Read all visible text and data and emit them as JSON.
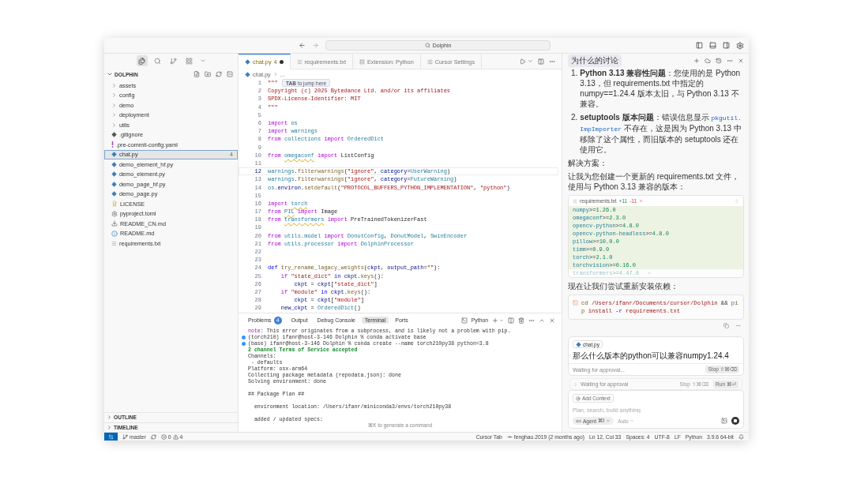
{
  "titlebar": {
    "search": "Dolphin"
  },
  "activity_bar": [
    {
      "kind": "files",
      "selected": true
    },
    {
      "kind": "search",
      "selected": false
    },
    {
      "kind": "source-control",
      "selected": false
    },
    {
      "kind": "extensions",
      "selected": false
    }
  ],
  "explorer": {
    "title": "DOLPHIN",
    "expanded": true,
    "items": [
      {
        "label": "assets",
        "kind": "folder",
        "expanded": false,
        "selected": false
      },
      {
        "label": "config",
        "kind": "folder",
        "expanded": false,
        "selected": false
      },
      {
        "label": "demo",
        "kind": "folder",
        "expanded": false,
        "selected": false
      },
      {
        "label": "deployment",
        "kind": "folder",
        "expanded": false,
        "selected": false
      },
      {
        "label": "utils",
        "kind": "folder",
        "expanded": false,
        "selected": false
      },
      {
        "label": ".gitignore",
        "kind": "git",
        "selected": false
      },
      {
        "label": ".pre-commit-config.yaml",
        "kind": "yaml",
        "selected": false
      },
      {
        "label": "chat.py",
        "kind": "python",
        "selected": true,
        "badge": "4"
      },
      {
        "label": "demo_element_hf.py",
        "kind": "python",
        "selected": false
      },
      {
        "label": "demo_element.py",
        "kind": "python",
        "selected": false
      },
      {
        "label": "demo_page_hf.py",
        "kind": "python",
        "selected": false
      },
      {
        "label": "demo_page.py",
        "kind": "python",
        "selected": false
      },
      {
        "label": "LICENSE",
        "kind": "license",
        "selected": false
      },
      {
        "label": "pyproject.toml",
        "kind": "toml",
        "selected": false
      },
      {
        "label": "README_CN.md",
        "kind": "markdown",
        "selected": false
      },
      {
        "label": "README.md",
        "kind": "info",
        "selected": false
      },
      {
        "label": "requirements.txt",
        "kind": "text",
        "selected": false
      }
    ],
    "sections": [
      {
        "title": "OUTLINE",
        "expanded": false
      },
      {
        "title": "TIMELINE",
        "expanded": false
      }
    ]
  },
  "editor": {
    "tabs": [
      {
        "label": "chat.py",
        "kind": "python",
        "badge": "4",
        "modified": true,
        "selected": true
      },
      {
        "label": "requirements.txt",
        "kind": "text",
        "modified": false,
        "selected": false
      },
      {
        "label": "Extension: Python",
        "kind": "extension",
        "modified": false,
        "selected": false
      },
      {
        "label": "Cursor Settings",
        "kind": "settings",
        "modified": false,
        "selected": false
      }
    ],
    "breadcrumb": {
      "file": "chat.py",
      "rest": "..."
    },
    "hint": {
      "key": "TAB",
      "text": "to jump here"
    },
    "lines": [
      {
        "number": "1",
        "current": false,
        "tokens": [
          {
            "text": "\"\"\"",
            "kind": "s"
          }
        ]
      },
      {
        "number": "2",
        "current": false,
        "tokens": [
          {
            "text": "Copyright (c) 2025 Bytedance Ltd. and/or its affiliates",
            "kind": "s"
          }
        ]
      },
      {
        "number": "3",
        "current": false,
        "tokens": [
          {
            "text": "SPDX-License-Identifier: MIT",
            "kind": "s"
          }
        ]
      },
      {
        "number": "4",
        "current": false,
        "tokens": [
          {
            "text": "\"\"\"",
            "kind": "s"
          }
        ]
      },
      {
        "number": "5",
        "current": false
      },
      {
        "number": "6",
        "current": false,
        "tokens": [
          {
            "text": "import",
            "kind": "k"
          },
          {
            "text": " os",
            "kind": "m"
          }
        ]
      },
      {
        "number": "7",
        "current": false,
        "tokens": [
          {
            "text": "import",
            "kind": "k"
          },
          {
            "text": " warnings",
            "kind": "m"
          }
        ]
      },
      {
        "number": "8",
        "current": false,
        "tokens": [
          {
            "text": "from",
            "kind": "k"
          },
          {
            "text": " collections ",
            "kind": "m"
          },
          {
            "text": "import",
            "kind": "k"
          },
          {
            "text": " OrderedDict",
            "kind": "c"
          }
        ]
      },
      {
        "number": "9",
        "current": false
      },
      {
        "number": "10",
        "current": false,
        "tokens": [
          {
            "text": "from ",
            "kind": "k"
          },
          {
            "text": "omegaconf",
            "kind": "w"
          },
          {
            "text": " import",
            "kind": "k"
          },
          {
            "text": " ListConfig",
            "kind": "p"
          }
        ]
      },
      {
        "number": "11",
        "current": false
      },
      {
        "number": "12",
        "current": true,
        "tokens": [
          {
            "text": "warnings",
            "kind": "m"
          },
          {
            "text": ".",
            "kind": "p"
          },
          {
            "text": "filterwarnings",
            "kind": "f"
          },
          {
            "text": "(",
            "kind": "p"
          },
          {
            "text": "\"ignore\"",
            "kind": "s"
          },
          {
            "text": ", ",
            "kind": "p"
          },
          {
            "text": "category",
            "kind": "v"
          },
          {
            "text": "=",
            "kind": "p"
          },
          {
            "text": "UserWarning",
            "kind": "c"
          },
          {
            "text": ")",
            "kind": "p"
          }
        ]
      },
      {
        "number": "13",
        "current": false,
        "tokens": [
          {
            "text": "warnings",
            "kind": "m"
          },
          {
            "text": ".",
            "kind": "p"
          },
          {
            "text": "filterwarnings",
            "kind": "f"
          },
          {
            "text": "(",
            "kind": "p"
          },
          {
            "text": "\"ignore\"",
            "kind": "s"
          },
          {
            "text": ", ",
            "kind": "p"
          },
          {
            "text": "category",
            "kind": "v"
          },
          {
            "text": "=",
            "kind": "p"
          },
          {
            "text": "FutureWarning",
            "kind": "c"
          },
          {
            "text": ")",
            "kind": "p"
          }
        ]
      },
      {
        "number": "14",
        "current": false,
        "tokens": [
          {
            "text": "os",
            "kind": "m"
          },
          {
            "text": ".",
            "kind": "p"
          },
          {
            "text": "environ",
            "kind": "v"
          },
          {
            "text": ".",
            "kind": "p"
          },
          {
            "text": "setdefault",
            "kind": "f"
          },
          {
            "text": "(",
            "kind": "p"
          },
          {
            "text": "\"PROTOCOL_BUFFERS_PYTHON_IMPLEMENTATION\"",
            "kind": "s"
          },
          {
            "text": ", ",
            "kind": "p"
          },
          {
            "text": "\"python\"",
            "kind": "s"
          },
          {
            "text": ")",
            "kind": "p"
          }
        ]
      },
      {
        "number": "15",
        "current": false
      },
      {
        "number": "16",
        "current": false,
        "tokens": [
          {
            "text": "import ",
            "kind": "k"
          },
          {
            "text": "torch",
            "kind": "w"
          }
        ]
      },
      {
        "number": "17",
        "current": false,
        "tokens": [
          {
            "text": "from ",
            "kind": "k"
          },
          {
            "text": "PIL",
            "kind": "w"
          },
          {
            "text": " import",
            "kind": "k"
          },
          {
            "text": " Image",
            "kind": "p"
          }
        ]
      },
      {
        "number": "18",
        "current": false,
        "tokens": [
          {
            "text": "from ",
            "kind": "k"
          },
          {
            "text": "transformers",
            "kind": "w"
          },
          {
            "text": " import",
            "kind": "k"
          },
          {
            "text": " PreTrainedTokenizerFast",
            "kind": "p"
          }
        ]
      },
      {
        "number": "19",
        "current": false
      },
      {
        "number": "20",
        "current": false,
        "tokens": [
          {
            "text": "from",
            "kind": "k"
          },
          {
            "text": " utils.model ",
            "kind": "m"
          },
          {
            "text": "import",
            "kind": "k"
          },
          {
            "text": " DonutConfig",
            "kind": "c"
          },
          {
            "text": ", ",
            "kind": "p"
          },
          {
            "text": "DonutModel",
            "kind": "c"
          },
          {
            "text": ", ",
            "kind": "p"
          },
          {
            "text": "SwinEncoder",
            "kind": "c"
          }
        ]
      },
      {
        "number": "21",
        "current": false,
        "tokens": [
          {
            "text": "from",
            "kind": "k"
          },
          {
            "text": " utils.processor ",
            "kind": "m"
          },
          {
            "text": "import",
            "kind": "k"
          },
          {
            "text": " DolphinProcessor",
            "kind": "c"
          }
        ]
      },
      {
        "number": "22",
        "current": false
      },
      {
        "number": "23",
        "current": false
      },
      {
        "number": "24",
        "current": false,
        "tokens": [
          {
            "text": "def ",
            "kind": "d"
          },
          {
            "text": "try_rename_lagacy_weights",
            "kind": "f"
          },
          {
            "text": "(",
            "kind": "p"
          },
          {
            "text": "ckpt",
            "kind": "v"
          },
          {
            "text": ", ",
            "kind": "p"
          },
          {
            "text": "output_path",
            "kind": "v"
          },
          {
            "text": "=",
            "kind": "p"
          },
          {
            "text": "\"\"",
            "kind": "s"
          },
          {
            "text": "):",
            "kind": "p"
          }
        ]
      },
      {
        "number": "25",
        "current": false,
        "tokens": [
          {
            "text": "    if ",
            "kind": "k"
          },
          {
            "text": "\"state_dict\"",
            "kind": "s"
          },
          {
            "text": " in ",
            "kind": "d"
          },
          {
            "text": "ckpt",
            "kind": "v"
          },
          {
            "text": ".",
            "kind": "p"
          },
          {
            "text": "keys",
            "kind": "f"
          },
          {
            "text": "():",
            "kind": "p"
          }
        ]
      },
      {
        "number": "26",
        "current": false,
        "tokens": [
          {
            "text": "        ckpt",
            "kind": "v"
          },
          {
            "text": " = ",
            "kind": "p"
          },
          {
            "text": "ckpt",
            "kind": "v"
          },
          {
            "text": "[",
            "kind": "p"
          },
          {
            "text": "\"state_dict\"",
            "kind": "s"
          },
          {
            "text": "]",
            "kind": "p"
          }
        ]
      },
      {
        "number": "27",
        "current": false,
        "tokens": [
          {
            "text": "    if ",
            "kind": "k"
          },
          {
            "text": "\"module\"",
            "kind": "s"
          },
          {
            "text": " in ",
            "kind": "d"
          },
          {
            "text": "ckpt",
            "kind": "v"
          },
          {
            "text": ".",
            "kind": "p"
          },
          {
            "text": "keys",
            "kind": "f"
          },
          {
            "text": "():",
            "kind": "p"
          }
        ]
      },
      {
        "number": "28",
        "current": false,
        "tokens": [
          {
            "text": "        ckpt",
            "kind": "v"
          },
          {
            "text": " = ",
            "kind": "p"
          },
          {
            "text": "ckpt",
            "kind": "v"
          },
          {
            "text": "[",
            "kind": "p"
          },
          {
            "text": "\"module\"",
            "kind": "s"
          },
          {
            "text": "]",
            "kind": "p"
          }
        ]
      },
      {
        "number": "29",
        "current": false,
        "tokens": [
          {
            "text": "    new_ckpt",
            "kind": "v"
          },
          {
            "text": " = ",
            "kind": "p"
          },
          {
            "text": "OrderedDict",
            "kind": "c"
          },
          {
            "text": "()",
            "kind": "p"
          }
        ]
      }
    ]
  },
  "panel": {
    "tabs": [
      {
        "label": "Problems",
        "badge": "4",
        "selected": false
      },
      {
        "label": "Output",
        "selected": false
      },
      {
        "label": "Debug Console",
        "selected": false
      },
      {
        "label": "Terminal",
        "selected": true
      },
      {
        "label": "Ports",
        "selected": false
      }
    ],
    "shell": "Python",
    "lines": [
      {
        "dot": false,
        "tokens": [
          {
            "text": "note",
            "kind": "note"
          },
          {
            "text": ": This error originates from a subprocess, and is likely not a problem with pip.",
            "kind": "p"
          }
        ]
      },
      {
        "dot": true,
        "tokens": [
          {
            "text": "(torch210) ifanr@host-3-146 Dolphin % conda activate base",
            "kind": "p"
          }
        ]
      },
      {
        "dot": true,
        "tokens": [
          {
            "text": "(base) ifanr@host-3-146 Dolphin % conda create --name torch210py38 python=3.8",
            "kind": "p"
          }
        ]
      },
      {
        "dot": false,
        "tokens": [
          {
            "text": "2 channel Terms of Service accepted",
            "kind": "ok"
          }
        ]
      },
      {
        "dot": false,
        "tokens": [
          {
            "text": "Channels:",
            "kind": "p"
          }
        ]
      },
      {
        "dot": false,
        "tokens": [
          {
            "text": " - defaults",
            "kind": "p"
          }
        ]
      },
      {
        "dot": false,
        "tokens": [
          {
            "text": "Platform: osx-arm64",
            "kind": "p"
          }
        ]
      },
      {
        "dot": false,
        "tokens": [
          {
            "text": "Collecting package metadata (repodata.json): done",
            "kind": "p"
          }
        ]
      },
      {
        "dot": false,
        "tokens": [
          {
            "text": "Solving environment: done",
            "kind": "p"
          }
        ]
      },
      {
        "dot": false,
        "gap_before": true,
        "tokens": [
          {
            "text": "## Package Plan ##",
            "kind": "p"
          }
        ]
      },
      {
        "dot": false,
        "gap_before": true,
        "tokens": [
          {
            "text": "  environment location: /Users/ifanr/miniconda3/envs/torch210py38",
            "kind": "p"
          }
        ]
      },
      {
        "dot": false,
        "gap_before": true,
        "tokens": [
          {
            "text": "  added / updated specs:",
            "kind": "p"
          }
        ]
      }
    ],
    "hint": "⌘K to generate a command"
  },
  "chat": {
    "title": "为什么的讨论",
    "items": [
      {
        "number": "1.",
        "parts": [
          {
            "kind": "text",
            "text": "**Python 3.13 兼容性问题**：您使用的是 Python 3.13，但 requirements.txt 中指定的 numpy==1.24.4 版本太旧，与 Python 3.13 不兼容。"
          }
        ]
      },
      {
        "number": "2.",
        "parts": [
          {
            "kind": "text",
            "text": "**setuptools 版本问题**：错误信息显示 "
          },
          {
            "kind": "code",
            "text": "pkgutil.ImpImporter"
          },
          {
            "kind": "text",
            "text": " 不存在，这是因为 Python 3.13 中移除了这个属性，而旧版本的 setuptools 还在使用它。"
          }
        ]
      }
    ],
    "solution": "解决方案：",
    "intro": "让我为您创建一个更新的 requirements.txt 文件，使用与 Python 3.13 兼容的版本：",
    "file_block": {
      "name": "requirements.txt",
      "added": "+11",
      "removed": "-11",
      "lines": [
        {
          "name": "numpy",
          "op": ">=",
          "version": "1.26.0",
          "faded": false
        },
        {
          "name": "omegaconf",
          "op": ">=",
          "version": "2.3.0",
          "faded": false
        },
        {
          "name": "opencv-python",
          "op": ">=",
          "version": "4.8.0",
          "faded": false
        },
        {
          "name": "opencv-python-headless",
          "op": ">=",
          "version": "4.8.0",
          "faded": false
        },
        {
          "name": "pillow",
          "op": ">=",
          "version": "10.0.0",
          "faded": false
        },
        {
          "name": "timm",
          "op": ">=",
          "version": "0.9.0",
          "faded": false
        },
        {
          "name": "torch",
          "op": ">=",
          "version": "2.1.0",
          "faded": false
        },
        {
          "name": "torchvision",
          "op": ">=",
          "version": "0.16.0",
          "faded": false
        },
        {
          "name": "transformers",
          "op": ">=",
          "version": "4.47.0",
          "faded": true
        }
      ]
    },
    "after": "现在让我们尝试重新安装依赖：",
    "command": [
      {
        "text": "cd",
        "kind": "cmd"
      },
      {
        "text": " /Users/ifanr/Documents/cursor/Dolphin",
        "kind": "arg"
      },
      {
        "text": " && ",
        "kind": "p"
      },
      {
        "text": "pip",
        "kind": "cmd"
      },
      {
        "text": " install",
        "kind": "arg"
      },
      {
        "text": " -r",
        "kind": "flag"
      },
      {
        "text": " requirements.txt",
        "kind": "arg"
      }
    ],
    "message": {
      "file": "chat.py",
      "text": "那么什么版本的python可以兼容numpy1.24.4",
      "status": "Waiting for approval...",
      "stop": {
        "label": "Stop",
        "shortcut": "⇧⌘⌫"
      }
    },
    "approval": {
      "expanded": false,
      "text": "Waiting for approval",
      "stop": {
        "label": "Stop",
        "shortcut": "⇧⌘⌫"
      },
      "run": {
        "label": "Run",
        "shortcut": "⌘⏎"
      }
    },
    "composer": {
      "context": "Add Context",
      "placeholder": "Plan, search, build anything",
      "mode": {
        "label": "Agent",
        "shortcut": "⌘I"
      },
      "model": "Auto"
    }
  },
  "status_bar": {
    "branch": "master",
    "errors": "0",
    "warnings": "4",
    "items": [
      {
        "kind": "text",
        "text": "Cursor Tab"
      },
      {
        "kind": "blame",
        "text": "fenghao.2019 (2 months ago)"
      },
      {
        "kind": "text",
        "text": "Ln 12, Col 33"
      },
      {
        "kind": "text",
        "text": "Spaces: 4"
      },
      {
        "kind": "text",
        "text": "UTF-8"
      },
      {
        "kind": "text",
        "text": "LF"
      },
      {
        "kind": "text",
        "text": "Python"
      },
      {
        "kind": "text",
        "text": "3.9.6 64-bit"
      }
    ]
  }
}
